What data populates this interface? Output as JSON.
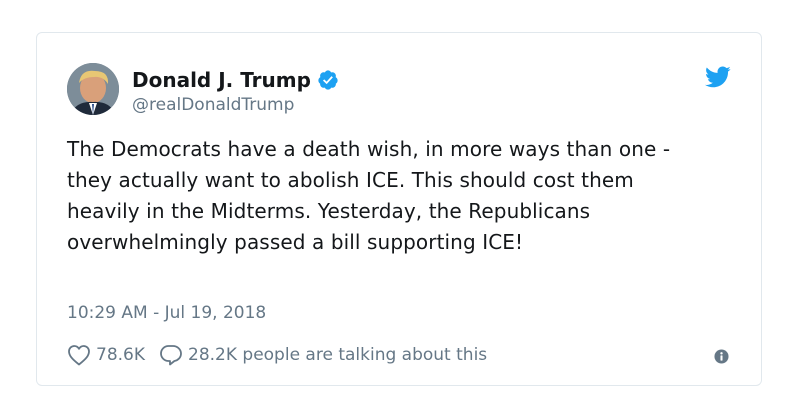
{
  "tweet": {
    "display_name": "Donald J. Trump",
    "handle": "@realDonaldTrump",
    "text": "The Democrats have a death wish, in more ways than one - they actually want to abolish ICE. This should cost them heavily in the Midterms. Yesterday, the Republicans overwhelmingly passed a bill supporting ICE!",
    "timestamp": "10:29 AM - Jul 19, 2018",
    "likes": "78.6K",
    "talking": "28.2K people are talking about this",
    "verified": true
  },
  "icons": {
    "verified": "verified-badge-icon",
    "brand": "twitter-bird-icon",
    "like": "heart-icon",
    "reply": "speech-bubble-icon",
    "info": "info-icon"
  },
  "colors": {
    "brand": "#1da1f2",
    "text": "#14171a",
    "secondary": "#657786",
    "border": "#e1e8ed"
  }
}
